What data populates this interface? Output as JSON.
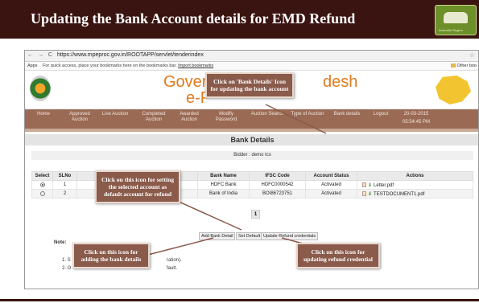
{
  "slide_title": "Updating the Bank Account details for EMD Refund",
  "browser": {
    "url": "https://www.mpeproc.gov.in/ROOTAPP/servlet/tenderindex",
    "nav_glyphs": "← → C",
    "bookmarks_apps": "Apps",
    "bookmarks_text": "For quick access, place your bookmarks here on the bookmarks bar.",
    "bookmarks_link": "Import bookmarks",
    "other_bookmarks": "Other boo"
  },
  "site": {
    "title_left": "Governm",
    "title_right": "desh",
    "title_line2": "e-P"
  },
  "nav": {
    "items": [
      "Home",
      "Approved Auction",
      "Live Auction",
      "Completed Auction",
      "Awarded Auction",
      "Modify Password",
      "Auction Search",
      "Type of Auction",
      "Bank details",
      "Logout"
    ],
    "date": "20-03-2015",
    "time": "05:54:45 PM"
  },
  "section_title": "Bank Details",
  "bidder": "Bidder : demo tcs",
  "table": {
    "headers": [
      "Select",
      "SLNo",
      "Bene",
      "",
      "Bank Name",
      "IFSC Code",
      "Account Status",
      "Actions"
    ],
    "rows": [
      {
        "slno": "1",
        "bene": "A",
        "col3": "1",
        "bank": "HDFC Bank",
        "ifsc": "HDFC0000542",
        "status": "Activated",
        "file": "Letter.pdf",
        "selected": true
      },
      {
        "slno": "2",
        "bene": "(",
        "col3": "",
        "bank": "Bank of India",
        "ifsc": "BOI86723751",
        "status": "Activated",
        "file": "TESTDOCUMENT1.pdf",
        "selected": false
      }
    ]
  },
  "page_number": "1",
  "buttons": {
    "add": "Add Bank Detail",
    "default": "Set Default",
    "update": "Update Refund credentials"
  },
  "note": {
    "label": "Note:",
    "line1_prefix": "1. S",
    "line1_suffix": "ration).",
    "line2_prefix": "2. O",
    "line2_suffix": "fault."
  },
  "callouts": {
    "bank_details": "Click on 'Bank Details' Icon for updating the bank account",
    "set_default": "Click on this icon for setting the selected account as default account for refund",
    "add_bank": "Click on this icon for adding the bank details",
    "update_refund": "Click on this icon for updating refund credential"
  },
  "colors": {
    "accent": "#3a1410",
    "callout": "#8a5a4a",
    "navbar": "#9a6a55",
    "site_title": "#e07a1f"
  }
}
